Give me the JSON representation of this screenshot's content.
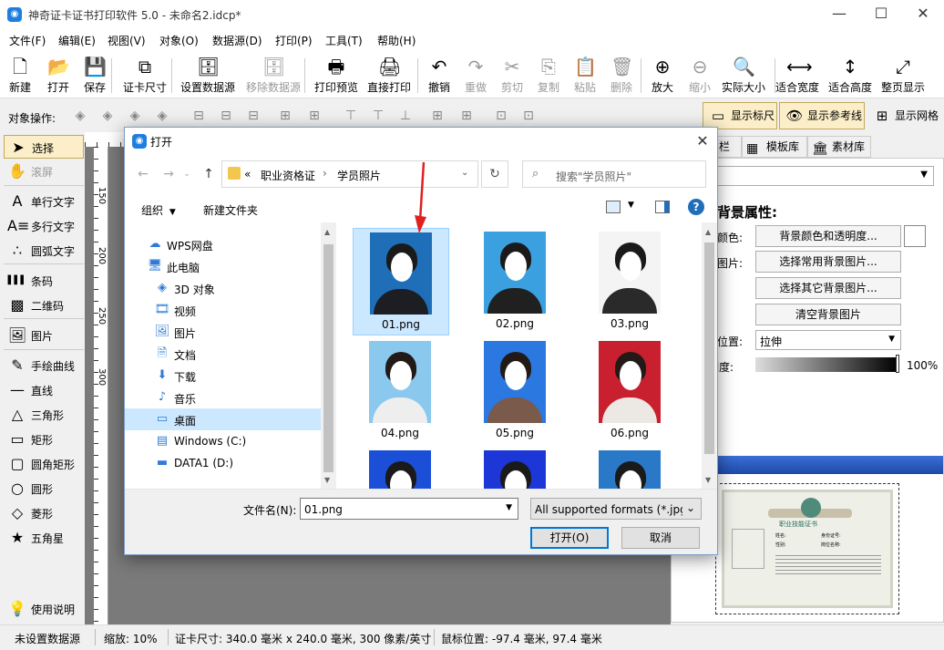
{
  "window": {
    "title": "神奇证卡证书打印软件 5.0 - 未命名2.idcp*"
  },
  "menu": [
    "文件(F)",
    "编辑(E)",
    "视图(V)",
    "对象(O)",
    "数据源(D)",
    "打印(P)",
    "工具(T)",
    "帮助(H)"
  ],
  "toolbar": [
    {
      "label": "新建",
      "icon": "new-file-icon",
      "glyph": "🗋",
      "disabled": false
    },
    {
      "label": "打开",
      "icon": "open-icon",
      "glyph": "📂",
      "disabled": false
    },
    {
      "label": "保存",
      "icon": "save-icon",
      "glyph": "💾",
      "disabled": false
    },
    {
      "label": "证卡尺寸",
      "icon": "card-size-icon",
      "glyph": "⧉",
      "disabled": false
    },
    {
      "label": "设置数据源",
      "icon": "database-icon",
      "glyph": "🗄",
      "disabled": false
    },
    {
      "label": "移除数据源",
      "icon": "remove-database-icon",
      "glyph": "🗄",
      "disabled": true
    },
    {
      "label": "打印预览",
      "icon": "print-preview-icon",
      "glyph": "🖶",
      "disabled": false
    },
    {
      "label": "直接打印",
      "icon": "print-icon",
      "glyph": "🖨",
      "disabled": false
    },
    {
      "label": "撤销",
      "icon": "undo-icon",
      "glyph": "↶",
      "disabled": false
    },
    {
      "label": "重做",
      "icon": "redo-icon",
      "glyph": "↷",
      "disabled": true
    },
    {
      "label": "剪切",
      "icon": "cut-icon",
      "glyph": "✂",
      "disabled": true
    },
    {
      "label": "复制",
      "icon": "copy-icon",
      "glyph": "⎘",
      "disabled": true
    },
    {
      "label": "粘贴",
      "icon": "paste-icon",
      "glyph": "📋",
      "disabled": true
    },
    {
      "label": "删除",
      "icon": "delete-icon",
      "glyph": "🗑",
      "disabled": true
    },
    {
      "label": "放大",
      "icon": "zoom-in-icon",
      "glyph": "⊕",
      "disabled": false
    },
    {
      "label": "缩小",
      "icon": "zoom-out-icon",
      "glyph": "⊖",
      "disabled": true
    },
    {
      "label": "实际大小",
      "icon": "actual-size-icon",
      "glyph": "🔍",
      "disabled": false
    },
    {
      "label": "适合宽度",
      "icon": "fit-width-icon",
      "glyph": "⟷",
      "disabled": false
    },
    {
      "label": "适合高度",
      "icon": "fit-height-icon",
      "glyph": "↕",
      "disabled": false
    },
    {
      "label": "整页显示",
      "icon": "fit-page-icon",
      "glyph": "⤢",
      "disabled": false
    }
  ],
  "objbar": {
    "label": "对象操作:",
    "show_ruler": "显示标尺",
    "show_guides": "显示参考线",
    "show_grid": "显示网格"
  },
  "tools": [
    {
      "label": "选择",
      "icon": "pointer-icon",
      "glyph": "➤",
      "selected": true,
      "disabled": false
    },
    {
      "label": "滚屏",
      "icon": "hand-icon",
      "glyph": "✋",
      "selected": false,
      "disabled": true
    },
    {
      "label": "单行文字",
      "icon": "single-line-text-icon",
      "glyph": "A",
      "selected": false,
      "disabled": false
    },
    {
      "label": "多行文字",
      "icon": "multi-line-text-icon",
      "glyph": "A≡",
      "selected": false,
      "disabled": false
    },
    {
      "label": "圆弧文字",
      "icon": "arc-text-icon",
      "glyph": "∴",
      "selected": false,
      "disabled": false
    },
    {
      "label": "条码",
      "icon": "barcode-icon",
      "glyph": "▌▌▌",
      "selected": false,
      "disabled": false
    },
    {
      "label": "二维码",
      "icon": "qrcode-icon",
      "glyph": "▩",
      "selected": false,
      "disabled": false
    },
    {
      "label": "图片",
      "icon": "image-icon",
      "glyph": "🖼",
      "selected": false,
      "disabled": false
    },
    {
      "label": "手绘曲线",
      "icon": "pen-icon",
      "glyph": "✎",
      "selected": false,
      "disabled": false
    },
    {
      "label": "直线",
      "icon": "line-icon",
      "glyph": "—",
      "selected": false,
      "disabled": false
    },
    {
      "label": "三角形",
      "icon": "triangle-icon",
      "glyph": "△",
      "selected": false,
      "disabled": false
    },
    {
      "label": "矩形",
      "icon": "rectangle-icon",
      "glyph": "▭",
      "selected": false,
      "disabled": false
    },
    {
      "label": "圆角矩形",
      "icon": "rounded-rectangle-icon",
      "glyph": "▢",
      "selected": false,
      "disabled": false
    },
    {
      "label": "圆形",
      "icon": "circle-icon",
      "glyph": "○",
      "selected": false,
      "disabled": false
    },
    {
      "label": "菱形",
      "icon": "diamond-icon",
      "glyph": "◇",
      "selected": false,
      "disabled": false
    },
    {
      "label": "五角星",
      "icon": "star-icon",
      "glyph": "★",
      "selected": false,
      "disabled": false
    }
  ],
  "help": {
    "label": "使用说明",
    "icon": "lightbulb-icon"
  },
  "ruler": {
    "marks": [
      "150",
      "200",
      "250",
      "300"
    ]
  },
  "rightpanel": {
    "tabs": [
      "栏",
      "模板库",
      "素材库"
    ],
    "title": "背景属性:",
    "color_label": "颜色:",
    "bg_color_btn": "背景颜色和透明度...",
    "image_label": "图片:",
    "common_img_btn": "选择常用背景图片...",
    "other_img_btn": "选择其它背景图片...",
    "clear_btn": "清空背景图片",
    "position_label": "位置:",
    "position_value": "拉伸",
    "opacity_label": "明度:",
    "opacity_value": "100%",
    "cert": {
      "title": "职业技能证书",
      "name": "姓名:",
      "id": "身份证号:",
      "gender": "性别:",
      "post": "岗位名称:"
    }
  },
  "status": {
    "datasource": "未设置数据源",
    "zoom": "缩放: 10%",
    "cardsize": "证卡尺寸: 340.0 毫米 x 240.0 毫米, 300 像素/英寸",
    "mouse": "鼠标位置: -97.4 毫米, 97.4 毫米"
  },
  "dialog": {
    "title": "打开",
    "breadcrumb": [
      "«",
      "职业资格证",
      "学员照片"
    ],
    "search_placeholder": "搜索\"学员照片\"",
    "organize": "组织",
    "new_folder": "新建文件夹",
    "nav": [
      {
        "label": "WPS网盘",
        "icon": "cloud-icon",
        "glyph": "☁",
        "indent": 1
      },
      {
        "label": "此电脑",
        "icon": "computer-icon",
        "glyph": "🖥",
        "indent": 1
      },
      {
        "label": "3D 对象",
        "icon": "3d-objects-icon",
        "glyph": "◈",
        "indent": 2
      },
      {
        "label": "视频",
        "icon": "video-icon",
        "glyph": "🎞",
        "indent": 2
      },
      {
        "label": "图片",
        "icon": "pictures-icon",
        "glyph": "🖼",
        "indent": 2
      },
      {
        "label": "文档",
        "icon": "documents-icon",
        "glyph": "🗎",
        "indent": 2
      },
      {
        "label": "下载",
        "icon": "downloads-icon",
        "glyph": "⬇",
        "indent": 2
      },
      {
        "label": "音乐",
        "icon": "music-icon",
        "glyph": "♪",
        "indent": 2
      },
      {
        "label": "桌面",
        "icon": "desktop-icon",
        "glyph": "▭",
        "indent": 2,
        "selected": true
      },
      {
        "label": "Windows (C:)",
        "icon": "drive-c-icon",
        "glyph": "▤",
        "indent": 2
      },
      {
        "label": "DATA1 (D:)",
        "icon": "drive-d-icon",
        "glyph": "▬",
        "indent": 2
      }
    ],
    "files": [
      {
        "name": "01.png",
        "bg": "#1e6fb8",
        "hair": "#1a1a1a",
        "body": "#1d1d24",
        "selected": true
      },
      {
        "name": "02.png",
        "bg": "#3aa0e0",
        "hair": "#1a1a1a",
        "body": "#202020",
        "selected": false
      },
      {
        "name": "03.png",
        "bg": "#f4f4f4",
        "hair": "#1a1a1a",
        "body": "#2a2a2a",
        "selected": false
      },
      {
        "name": "04.png",
        "bg": "#8ac8ee",
        "hair": "#221a16",
        "body": "#eeeeee",
        "selected": false
      },
      {
        "name": "05.png",
        "bg": "#2a78e0",
        "hair": "#221a16",
        "body": "#7a5a4a",
        "selected": false
      },
      {
        "name": "06.png",
        "bg": "#c8202e",
        "hair": "#221a16",
        "body": "#ece8e4",
        "selected": false
      },
      {
        "name": "",
        "bg": "#1c4fd8",
        "hair": "#1a1a1a",
        "body": "#1d1d24",
        "selected": false
      },
      {
        "name": "",
        "bg": "#1c36d8",
        "hair": "#1a1a1a",
        "body": "#202020",
        "selected": false
      },
      {
        "name": "",
        "bg": "#2a78c8",
        "hair": "#1a1a1a",
        "body": "#202020",
        "selected": false
      }
    ],
    "filename_label": "文件名(N):",
    "filename_value": "01.png",
    "filetype": "All supported formats (*.jpg,",
    "open_btn": "打开(O)",
    "cancel_btn": "取消"
  },
  "colors": {
    "accent": "#0078d7",
    "selection": "#cce8ff",
    "highlight": "#fbeec8",
    "arrow": "#e02020"
  }
}
